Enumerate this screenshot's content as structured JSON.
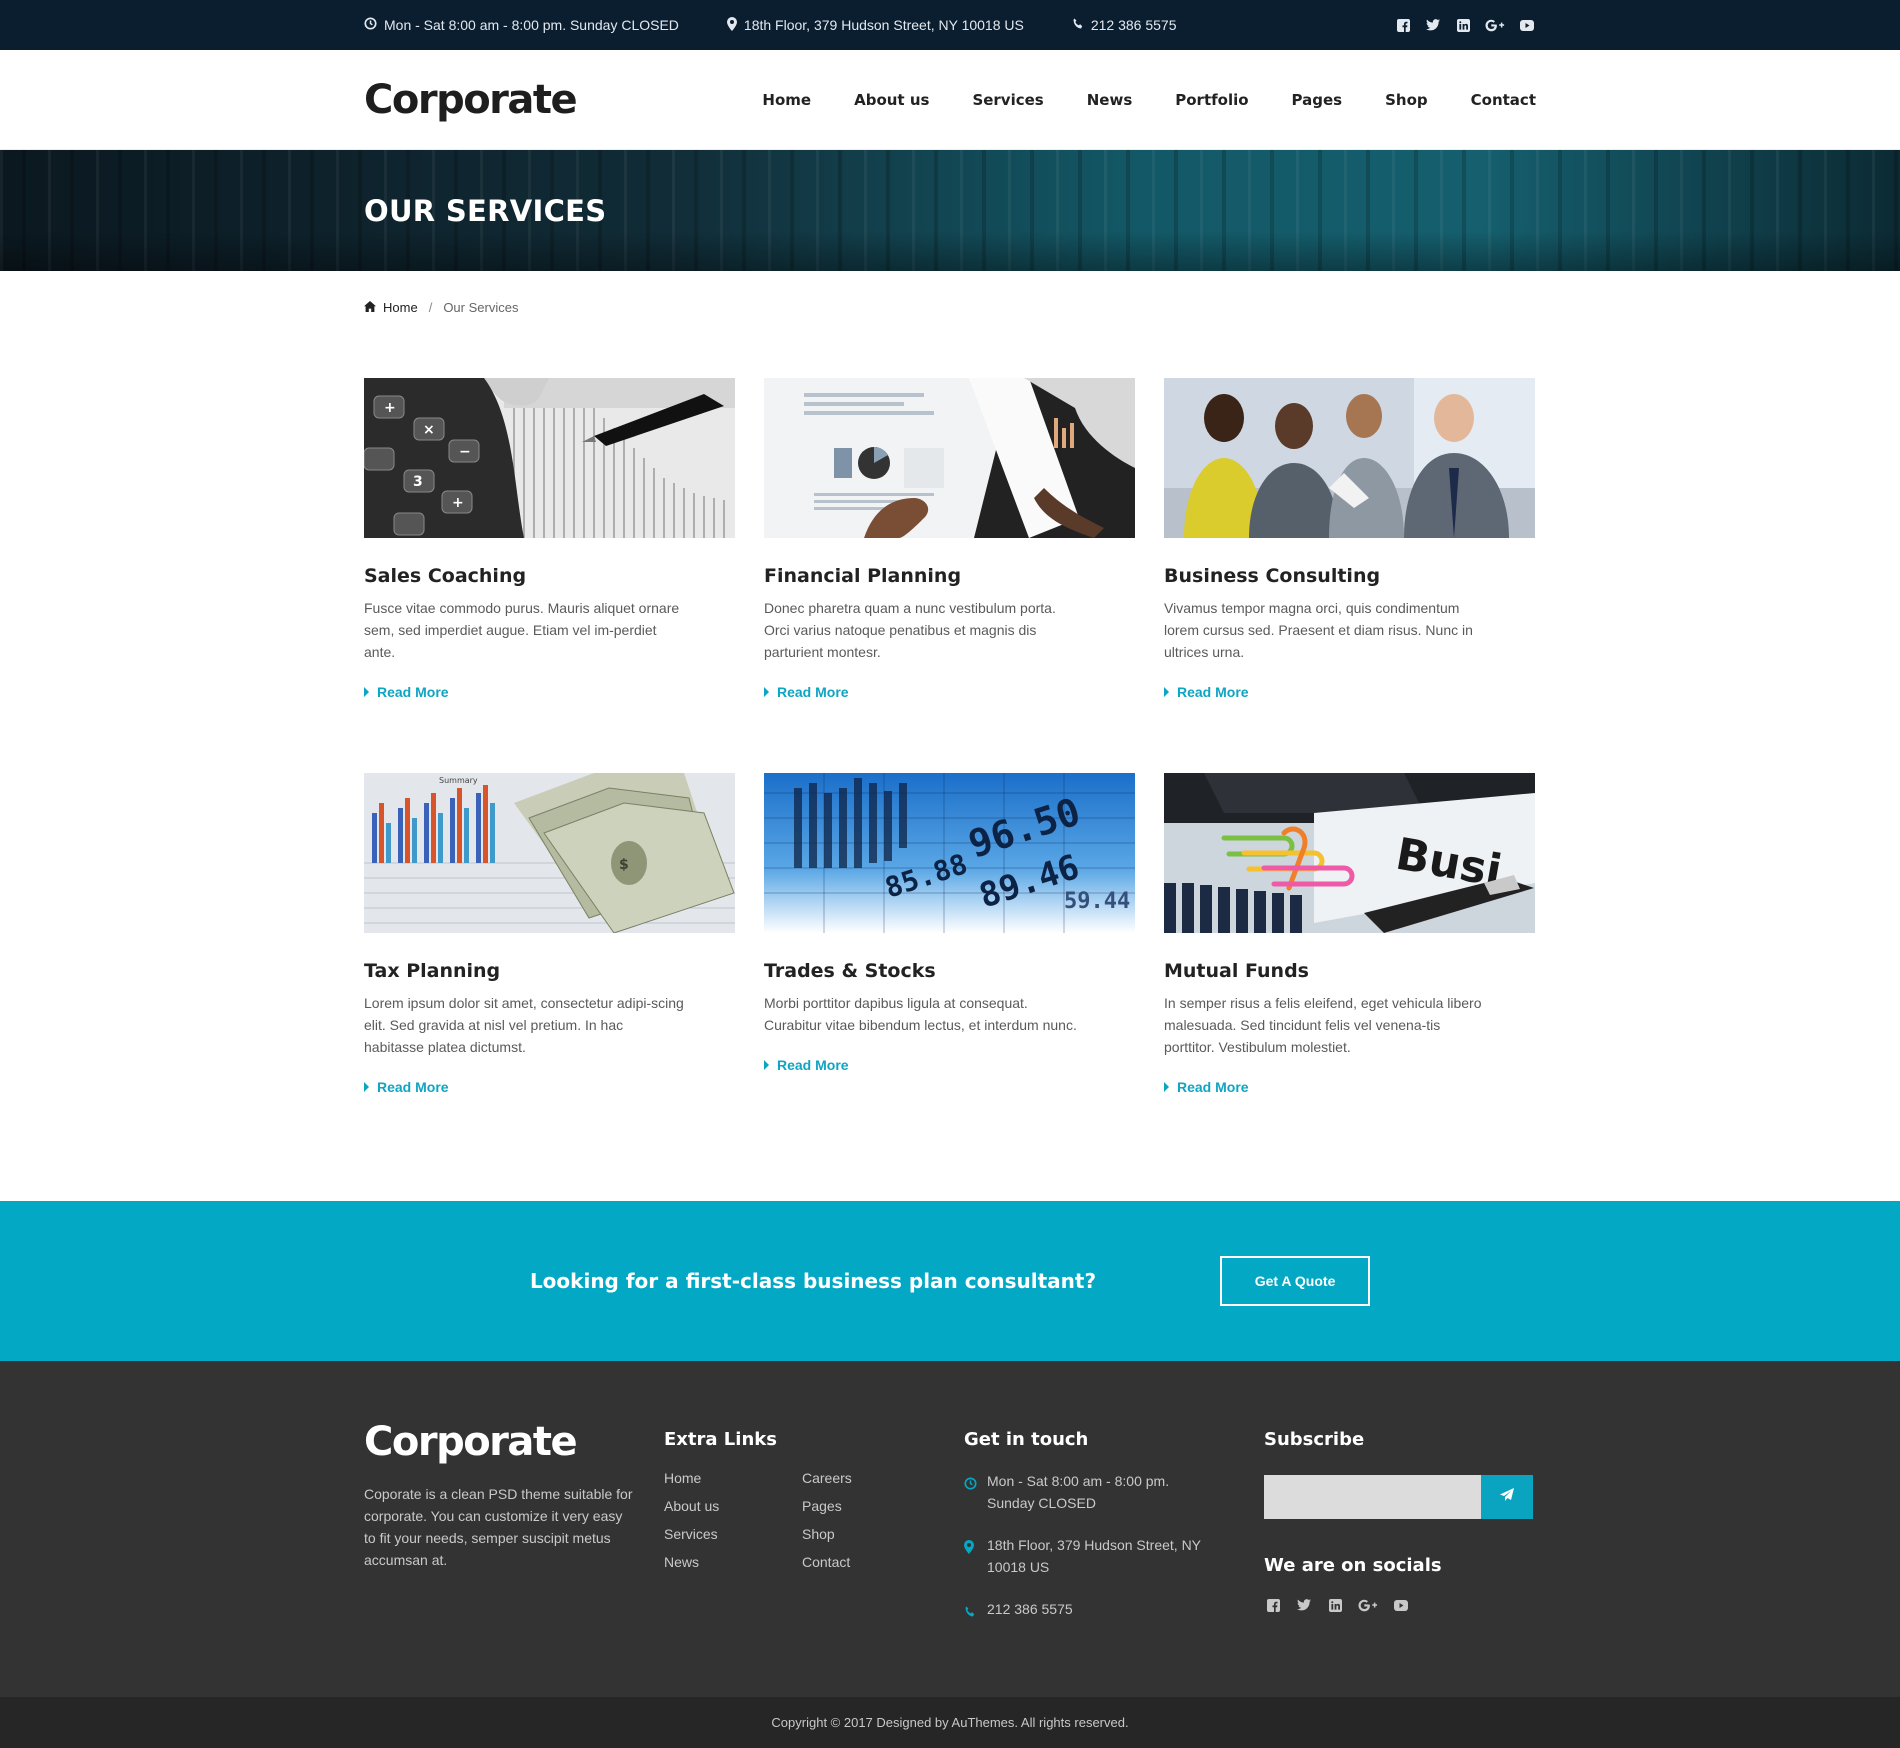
{
  "topbar": {
    "hours": "Mon - Sat 8:00 am - 8:00 pm. Sunday CLOSED",
    "address": "18th Floor, 379 Hudson Street, NY 10018 US",
    "phone": "212 386 5575",
    "socials": [
      "facebook-icon",
      "twitter-icon",
      "linkedin-icon",
      "google-plus-icon",
      "youtube-icon"
    ]
  },
  "header": {
    "logo": "Corporate",
    "nav": [
      "Home",
      "About us",
      "Services",
      "News",
      "Portfolio",
      "Pages",
      "Shop",
      "Contact"
    ]
  },
  "banner": {
    "title": "OUR SERVICES"
  },
  "breadcrumb": {
    "home": "Home",
    "separator": "/",
    "current": "Our Services"
  },
  "services": [
    {
      "title": "Sales Coaching",
      "text": "Fusce vitae commodo purus. Mauris aliquet ornare sem, sed imperdiet augue. Etiam vel im-perdiet ante.",
      "link": "Read More"
    },
    {
      "title": "Financial Planning",
      "text": "Donec pharetra quam a nunc vestibulum porta. Orci varius natoque penatibus et magnis dis parturient montesr.",
      "link": "Read More"
    },
    {
      "title": "Business Consulting",
      "text": "Vivamus tempor magna orci, quis condimentum lorem cursus sed. Praesent et diam risus. Nunc in ultrices urna.",
      "link": "Read More"
    },
    {
      "title": "Tax Planning",
      "text": "Lorem ipsum dolor sit amet, consectetur adipi-scing elit. Sed gravida at nisl vel pretium. In hac habitasse platea dictumst.",
      "link": "Read More"
    },
    {
      "title": "Trades & Stocks",
      "text": "Morbi porttitor dapibus ligula at consequat. Curabitur vitae bibendum lectus, et interdum nunc.",
      "link": "Read More"
    },
    {
      "title": "Mutual Funds",
      "text": "In semper risus a felis eleifend, eget vehicula libero malesuada. Sed tincidunt felis vel venena-tis porttitor. Vestibulum molestiet.",
      "link": "Read More"
    }
  ],
  "image_text": {
    "financial_stock": [
      "85.88",
      "96.50",
      "89.46",
      "59.44"
    ],
    "mutual_funds": "Busi",
    "tax_planning": "Summary"
  },
  "cta": {
    "text": "Looking for a first-class business plan consultant?",
    "button": "Get A Quote"
  },
  "footer": {
    "logo": "Corporate",
    "about": "Coporate is a clean PSD theme suitable for corporate. You can customize it very easy to fit your needs, semper suscipit metus accumsan at.",
    "links_title": "Extra Links",
    "links": [
      "Home",
      "Careers",
      "About us",
      "Pages",
      "Services",
      "Shop",
      "News",
      "Contact"
    ],
    "contact_title": "Get in touch",
    "hours": "Mon - Sat 8:00 am - 8:00 pm. Sunday CLOSED",
    "address": "18th Floor, 379 Hudson Street, NY 10018 US",
    "phone": "212 386 5575",
    "subscribe_title": "Subscribe",
    "subscribe_placeholder": "",
    "socials_title": "We are on socials"
  },
  "copyright": "Copyright © 2017 Designed by AuThemes. All rights reserved.",
  "colors": {
    "accent": "#03a8c4",
    "topbar": "#0b1e30",
    "footer": "#333333",
    "copyright_bar": "#262626"
  }
}
